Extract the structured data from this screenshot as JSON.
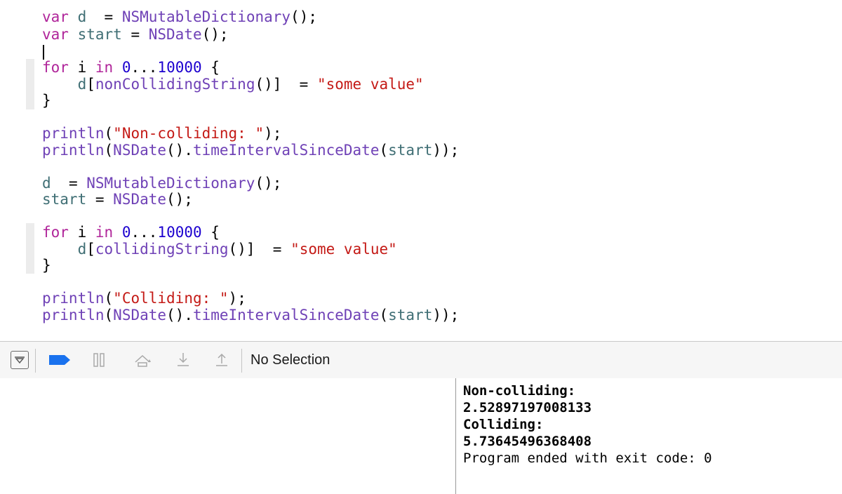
{
  "editor": {
    "lines": [
      {
        "id": "l1",
        "tokens": [
          [
            "kw",
            "var"
          ],
          [
            "pl",
            " "
          ],
          [
            "vr",
            "d"
          ],
          [
            "pl",
            "  = "
          ],
          [
            "ty",
            "NSMutableDictionary"
          ],
          [
            "pl",
            "();"
          ]
        ]
      },
      {
        "id": "l2",
        "tokens": [
          [
            "kw",
            "var"
          ],
          [
            "pl",
            " "
          ],
          [
            "vr",
            "start"
          ],
          [
            "pl",
            " = "
          ],
          [
            "ty",
            "NSDate"
          ],
          [
            "pl",
            "();"
          ]
        ]
      },
      {
        "id": "l4",
        "tokens": [
          [
            "kw",
            "for"
          ],
          [
            "pl",
            " i "
          ],
          [
            "kw",
            "in"
          ],
          [
            "pl",
            " "
          ],
          [
            "num",
            "0"
          ],
          [
            "pl",
            "..."
          ],
          [
            "num",
            "10000"
          ],
          [
            "pl",
            " {"
          ]
        ]
      },
      {
        "id": "l5",
        "tokens": [
          [
            "pl",
            "    "
          ],
          [
            "vr",
            "d"
          ],
          [
            "pl",
            "["
          ],
          [
            "ty",
            "nonCollidingString"
          ],
          [
            "pl",
            "()]  = "
          ],
          [
            "str",
            "\"some value\""
          ]
        ]
      },
      {
        "id": "l6",
        "tokens": [
          [
            "pl",
            "}"
          ]
        ]
      },
      {
        "id": "l8",
        "tokens": [
          [
            "ty",
            "println"
          ],
          [
            "pl",
            "("
          ],
          [
            "str",
            "\"Non-colliding: \""
          ],
          [
            "pl",
            ");"
          ]
        ]
      },
      {
        "id": "l9",
        "tokens": [
          [
            "ty",
            "println"
          ],
          [
            "pl",
            "("
          ],
          [
            "ty",
            "NSDate"
          ],
          [
            "pl",
            "()."
          ],
          [
            "ty",
            "timeIntervalSinceDate"
          ],
          [
            "pl",
            "("
          ],
          [
            "vr",
            "start"
          ],
          [
            "pl",
            "));"
          ]
        ]
      },
      {
        "id": "l11",
        "tokens": [
          [
            "vr",
            "d"
          ],
          [
            "pl",
            "  = "
          ],
          [
            "ty",
            "NSMutableDictionary"
          ],
          [
            "pl",
            "();"
          ]
        ]
      },
      {
        "id": "l12",
        "tokens": [
          [
            "vr",
            "start"
          ],
          [
            "pl",
            " = "
          ],
          [
            "ty",
            "NSDate"
          ],
          [
            "pl",
            "();"
          ]
        ]
      },
      {
        "id": "l14",
        "tokens": [
          [
            "kw",
            "for"
          ],
          [
            "pl",
            " i "
          ],
          [
            "kw",
            "in"
          ],
          [
            "pl",
            " "
          ],
          [
            "num",
            "0"
          ],
          [
            "pl",
            "..."
          ],
          [
            "num",
            "10000"
          ],
          [
            "pl",
            " {"
          ]
        ]
      },
      {
        "id": "l15",
        "tokens": [
          [
            "pl",
            "    "
          ],
          [
            "vr",
            "d"
          ],
          [
            "pl",
            "["
          ],
          [
            "ty",
            "collidingString"
          ],
          [
            "pl",
            "()]  = "
          ],
          [
            "str",
            "\"some value\""
          ]
        ]
      },
      {
        "id": "l16",
        "tokens": [
          [
            "pl",
            "}"
          ]
        ]
      },
      {
        "id": "l18",
        "tokens": [
          [
            "ty",
            "println"
          ],
          [
            "pl",
            "("
          ],
          [
            "str",
            "\"Colliding: \""
          ],
          [
            "pl",
            ");"
          ]
        ]
      },
      {
        "id": "l19",
        "tokens": [
          [
            "ty",
            "println"
          ],
          [
            "pl",
            "("
          ],
          [
            "ty",
            "NSDate"
          ],
          [
            "pl",
            "()."
          ],
          [
            "ty",
            "timeIntervalSinceDate"
          ],
          [
            "pl",
            "("
          ],
          [
            "vr",
            "start"
          ],
          [
            "pl",
            "));"
          ]
        ]
      }
    ]
  },
  "debug_bar": {
    "status_label": "No Selection",
    "icons": [
      "hide-debug-area-icon",
      "breakpoints-toggle-icon",
      "pause-continue-icon",
      "step-over-icon",
      "step-into-icon",
      "step-out-icon"
    ],
    "accent": "#1a72ee"
  },
  "console": {
    "lines": [
      "Non-colliding:",
      "2.52897197008133",
      "Colliding:",
      "5.73645496368408",
      "Program ended with exit code: 0"
    ]
  }
}
